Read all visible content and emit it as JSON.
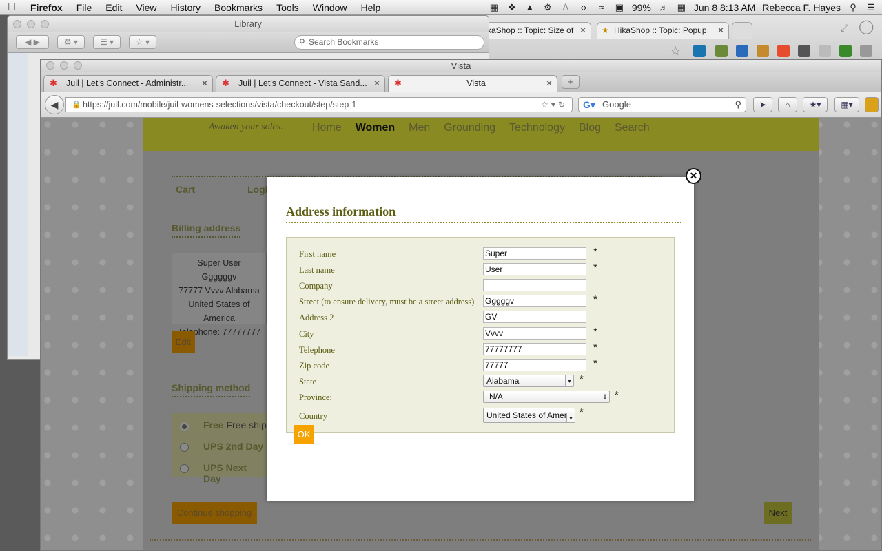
{
  "menubar": {
    "app": "Firefox",
    "items": [
      "File",
      "Edit",
      "View",
      "History",
      "Bookmarks",
      "Tools",
      "Window",
      "Help"
    ],
    "battery": "99%",
    "datetime": "Jun 8  8:13 AM",
    "user": "Rebecca F. Hayes"
  },
  "bg_browser": {
    "tabs": [
      {
        "label": "kaShop :: Topic: Size of"
      },
      {
        "label": "HikaShop :: Topic: Popup"
      }
    ]
  },
  "library": {
    "title": "Library",
    "search_placeholder": "Search Bookmarks"
  },
  "browser": {
    "window_title": "Vista",
    "tabs": [
      {
        "label": "Juil | Let's Connect - Administr..."
      },
      {
        "label": "Juil | Let's Connect - Vista Sand..."
      },
      {
        "label": "Vista"
      }
    ],
    "url": "https://juil.com/mobile/juil-womens-selections/vista/checkout/step/step-1",
    "search_engine": "Google"
  },
  "site": {
    "tagline": "Awaken your soles.",
    "nav": [
      "Home",
      "Women",
      "Men",
      "Grounding",
      "Technology",
      "Blog",
      "Search"
    ],
    "steps": [
      "Cart",
      "Logi"
    ],
    "billing_heading": "Billing address",
    "billing_lines": [
      "Super User",
      "Ggggggv",
      "77777 Vvvv Alabama",
      "United States of America",
      "Telephone: 77777777"
    ],
    "edit_label": "Edit",
    "shipping_heading": "Shipping method",
    "shipping_options": [
      {
        "label": "Free",
        "extra": "Free ship"
      },
      {
        "label": "UPS 2nd Day",
        "extra": ""
      },
      {
        "label": "UPS Next Day",
        "extra": ""
      }
    ],
    "continue_label": "Continue shopping",
    "next_label": "Next"
  },
  "modal": {
    "title": "Address information",
    "fields": [
      {
        "label": "First name",
        "value": "Super",
        "required": "*"
      },
      {
        "label": "Last name",
        "value": "User",
        "required": "*"
      },
      {
        "label": "Company",
        "value": "",
        "required": ""
      },
      {
        "label": "Street (to ensure delivery, must be a street address)",
        "value": "Gggggv",
        "required": "*"
      },
      {
        "label": "Address 2",
        "value": "GV",
        "required": ""
      },
      {
        "label": "City",
        "value": "Vvvv",
        "required": "*"
      },
      {
        "label": "Telephone",
        "value": "77777777",
        "required": "*"
      },
      {
        "label": "Zip code",
        "value": "77777",
        "required": "*"
      }
    ],
    "selects": [
      {
        "label": "State",
        "value": "Alabama",
        "required": "*"
      },
      {
        "label": "Province:",
        "value": "N/A",
        "required": "*"
      },
      {
        "label": "Country",
        "value": "United States of Amer",
        "required": "*"
      }
    ],
    "ok_label": "OK"
  },
  "colors": {
    "accent_orange": "#f6a300",
    "olive": "#8a8a22",
    "panel": "#efefdf"
  }
}
